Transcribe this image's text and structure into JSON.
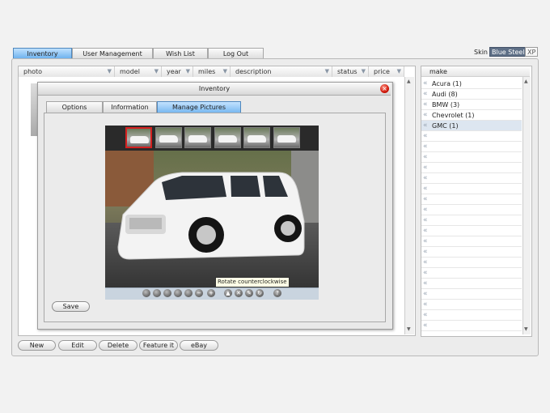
{
  "top_tabs": [
    "Inventory",
    "User Management",
    "Wish List",
    "Log Out"
  ],
  "skin": {
    "label": "Skin",
    "options": [
      "Blue Steel",
      "XP"
    ],
    "selected": "Blue Steel"
  },
  "grid": {
    "columns": [
      "photo",
      "model",
      "year",
      "miles",
      "description",
      "status",
      "price"
    ]
  },
  "make_panel": {
    "header": "make",
    "items": [
      "Acura (1)",
      "Audi (8)",
      "BMW (3)",
      "Chevrolet (1)",
      "GMC (1)"
    ],
    "selected": "GMC (1)"
  },
  "bottom_buttons": [
    "New",
    "Edit",
    "Delete",
    "Feature it",
    "eBay"
  ],
  "dialog": {
    "title": "Inventory",
    "tabs": [
      "Options",
      "Information",
      "Manage Pictures"
    ],
    "active_tab": "Manage Pictures",
    "thumbnail_count": 6,
    "selected_thumbnail": 1,
    "tooltip": "Rotate counterclockwise",
    "save_label": "Save",
    "toolbar_icons": [
      "rotate-counterclockwise-icon",
      "rotate-clockwise-icon",
      "flip-icon",
      "zoom-icon",
      "crop-icon",
      "minus-icon",
      "add-icon",
      "move-up-icon",
      "delete-icon",
      "edit-icon",
      "refresh-icon",
      "help-icon"
    ]
  },
  "colors": {
    "accent": "#6fb2ee",
    "close": "#d1180b",
    "selection": "#d52020"
  }
}
